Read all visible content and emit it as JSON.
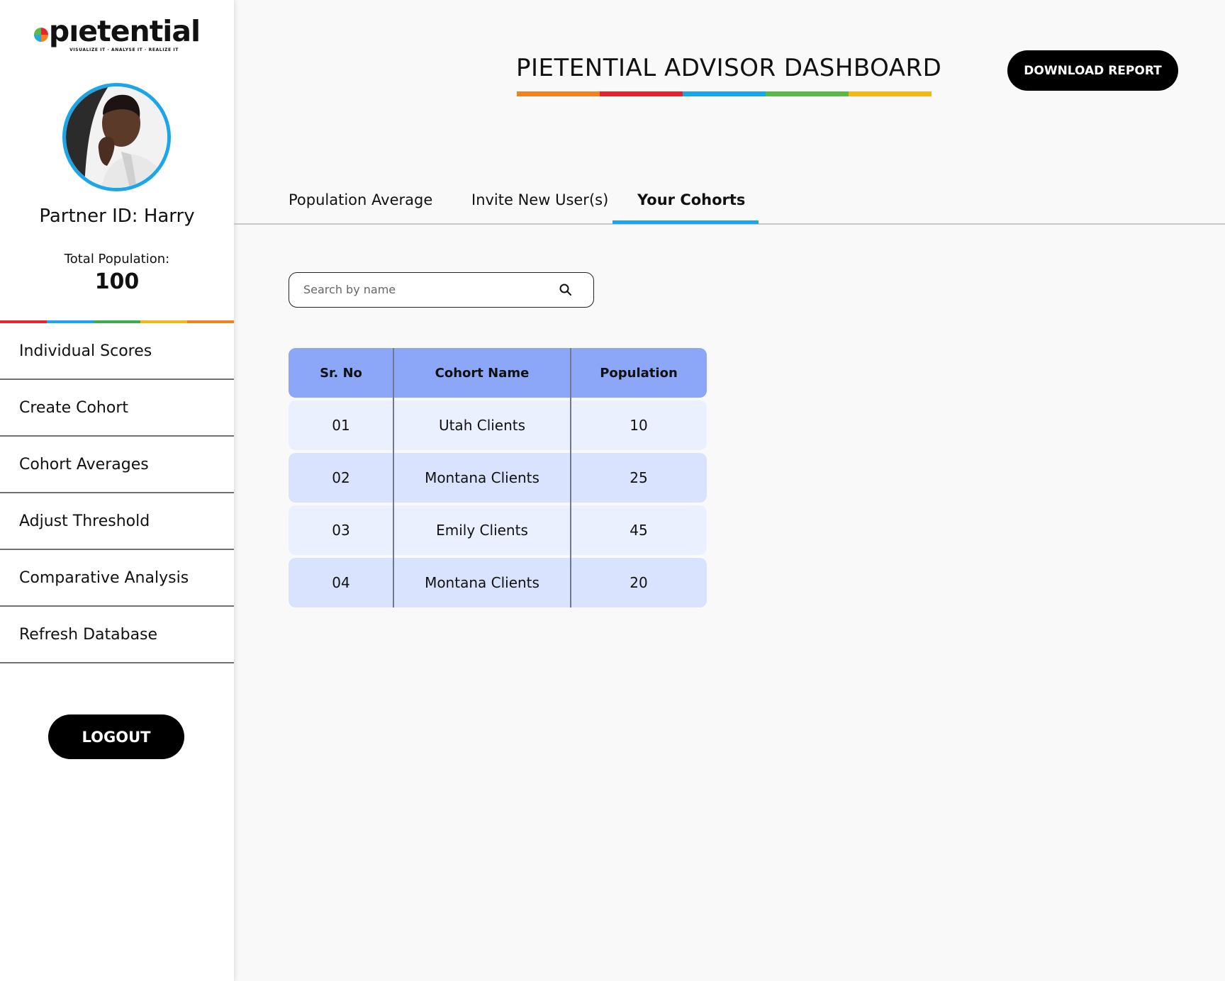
{
  "brand": {
    "logo_text": "pıetential",
    "tagline": "VISUALIZE IT · ANALYSE IT · REALIZE IT",
    "colors": [
      "#e9232b",
      "#1aa6e8",
      "#3dac4a",
      "#f6b61a",
      "#f48120"
    ]
  },
  "sidebar": {
    "partner_id": "Partner ID: Harry",
    "population_label": "Total Population:",
    "population_value": "100",
    "items": [
      {
        "label": "Individual Scores"
      },
      {
        "label": "Create Cohort"
      },
      {
        "label": "Cohort Averages"
      },
      {
        "label": "Adjust Threshold"
      },
      {
        "label": "Comparative Analysis"
      },
      {
        "label": "Refresh Database"
      }
    ],
    "logout_label": "LOGOUT"
  },
  "header": {
    "title": "PIETENTIAL ADVISOR DASHBOARD",
    "title_bar_colors": [
      "#f48120",
      "#e9232b",
      "#1aa6e8",
      "#5bb947",
      "#f6b61a"
    ],
    "download_label": "DOWNLOAD REPORT"
  },
  "tabs": [
    {
      "label": "Population Average",
      "active": false
    },
    {
      "label": "Invite New User(s)",
      "active": false
    },
    {
      "label": "Your Cohorts",
      "active": true
    }
  ],
  "search": {
    "placeholder": "Search by name",
    "value": ""
  },
  "table": {
    "columns": [
      "Sr. No",
      "Cohort Name",
      "Population"
    ],
    "rows": [
      [
        "01",
        "Utah Clients",
        "10"
      ],
      [
        "02",
        "Montana Clients",
        "25"
      ],
      [
        "03",
        "Emily Clients",
        "45"
      ],
      [
        "04",
        "Montana Clients",
        "20"
      ]
    ]
  }
}
